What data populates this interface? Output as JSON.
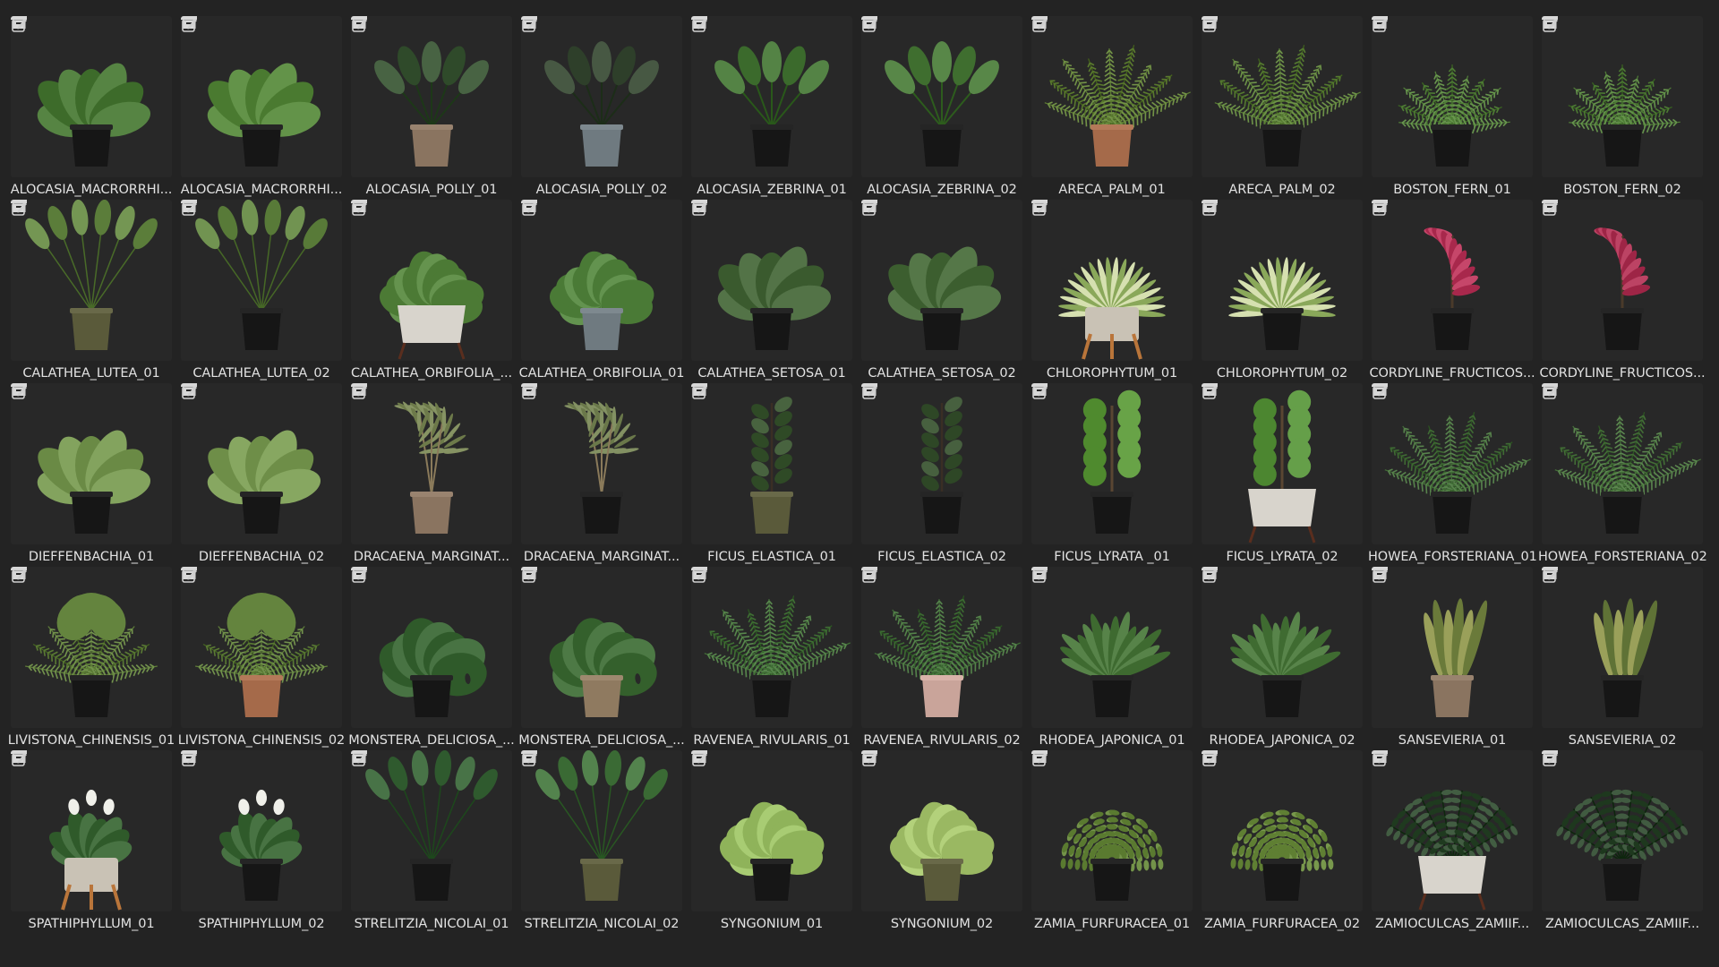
{
  "assets": [
    {
      "label": "ALOCASIA_MACRORRHI...",
      "plant": "broad",
      "leaf": "#3d6b2a",
      "pot": "black"
    },
    {
      "label": "ALOCASIA_MACRORRHI...",
      "plant": "broad",
      "leaf": "#4a7a30",
      "pot": "black"
    },
    {
      "label": "ALOCASIA_POLLY_01",
      "plant": "arrow",
      "leaf": "#2f4a2a",
      "pot": "tan"
    },
    {
      "label": "ALOCASIA_POLLY_02",
      "plant": "arrow",
      "leaf": "#2e3f2a",
      "pot": "grey"
    },
    {
      "label": "ALOCASIA_ZEBRINA_01",
      "plant": "arrow",
      "leaf": "#3b6a2c",
      "pot": "black"
    },
    {
      "label": "ALOCASIA_ZEBRINA_02",
      "plant": "arrow",
      "leaf": "#3f6e2f",
      "pot": "black"
    },
    {
      "label": "ARECA_PALM_01",
      "plant": "palm",
      "leaf": "#5a7a2e",
      "pot": "terracotta"
    },
    {
      "label": "ARECA_PALM_02",
      "plant": "palm",
      "leaf": "#557a30",
      "pot": "black"
    },
    {
      "label": "BOSTON_FERN_01",
      "plant": "fern",
      "leaf": "#4f7d35",
      "pot": "black"
    },
    {
      "label": "BOSTON_FERN_02",
      "plant": "fern",
      "leaf": "#4c7a33",
      "pot": "black"
    },
    {
      "label": "CALATHEA_LUTEA_01",
      "plant": "tall",
      "leaf": "#5b7d3a",
      "pot": "olive"
    },
    {
      "label": "CALATHEA_LUTEA_02",
      "plant": "tall",
      "leaf": "#587a38",
      "pot": "black"
    },
    {
      "label": "CALATHEA_ORBIFOLIA_...",
      "plant": "bushy",
      "leaf": "#4c7a35",
      "pot": "white"
    },
    {
      "label": "CALATHEA_ORBIFOLIA_01",
      "plant": "bushy",
      "leaf": "#4a7a36",
      "pot": "grey"
    },
    {
      "label": "CALATHEA_SETOSA_01",
      "plant": "broad",
      "leaf": "#3a5a2e",
      "pot": "black"
    },
    {
      "label": "CALATHEA_SETOSA_02",
      "plant": "broad",
      "leaf": "#3c5e2f",
      "pot": "black"
    },
    {
      "label": "CHLOROPHYTUM_01",
      "plant": "spider",
      "leaf": "#8aa85a",
      "pot": "stand"
    },
    {
      "label": "CHLOROPHYTUM_02",
      "plant": "spider",
      "leaf": "#8aa85a",
      "pot": "black"
    },
    {
      "label": "CORDYLINE_FRUCTICOS...",
      "plant": "cordyline",
      "leaf": "#a8284c",
      "pot": "black"
    },
    {
      "label": "CORDYLINE_FRUCTICOS...",
      "plant": "cordyline",
      "leaf": "#9e2546",
      "pot": "black"
    },
    {
      "label": "DIEFFENBACHIA_01",
      "plant": "broad",
      "leaf": "#6a8a45",
      "pot": "black"
    },
    {
      "label": "DIEFFENBACHIA_02",
      "plant": "broad",
      "leaf": "#6e8e48",
      "pot": "black"
    },
    {
      "label": "DRACAENA_MARGINAT...",
      "plant": "dracaena",
      "leaf": "#6d7a4a",
      "pot": "tan"
    },
    {
      "label": "DRACAENA_MARGINAT...",
      "plant": "dracaena",
      "leaf": "#6a784a",
      "pot": "black"
    },
    {
      "label": "FICUS_ELASTICA_01",
      "plant": "ficus",
      "leaf": "#2f4a26",
      "pot": "olive"
    },
    {
      "label": "FICUS_ELASTICA_02",
      "plant": "ficus",
      "leaf": "#2e4726",
      "pot": "black"
    },
    {
      "label": "FICUS_LYRATA _01",
      "plant": "fiddle",
      "leaf": "#4f8a2e",
      "pot": "black"
    },
    {
      "label": "FICUS_LYRATA_02",
      "plant": "fiddle",
      "leaf": "#4c8630",
      "pot": "white"
    },
    {
      "label": "HOWEA_FORSTERIANA_01",
      "plant": "palm",
      "leaf": "#3f6a34",
      "pot": "black"
    },
    {
      "label": "HOWEA_FORSTERIANA_02",
      "plant": "palm",
      "leaf": "#426d36",
      "pot": "black"
    },
    {
      "label": "LIVISTONA_CHINENSIS_01",
      "plant": "fanpalm",
      "leaf": "#5a7a34",
      "pot": "black"
    },
    {
      "label": "LIVISTONA_CHINENSIS_02",
      "plant": "fanpalm",
      "leaf": "#5a7a34",
      "pot": "terracotta"
    },
    {
      "label": "MONSTERA_DELICIOSA_...",
      "plant": "monstera",
      "leaf": "#2f5a2a",
      "pot": "black"
    },
    {
      "label": "MONSTERA_DELICIOSA_...",
      "plant": "monstera",
      "leaf": "#34602c",
      "pot": "basket"
    },
    {
      "label": "RAVENEA_RIVULARIS_01",
      "plant": "palm",
      "leaf": "#3f6e34",
      "pot": "black"
    },
    {
      "label": "RAVENEA_RIVULARIS_02",
      "plant": "palm",
      "leaf": "#3c6a32",
      "pot": "pink"
    },
    {
      "label": "RHODEA_JAPONICA_01",
      "plant": "spiky",
      "leaf": "#3e6a30",
      "pot": "black"
    },
    {
      "label": "RHODEA_JAPONICA_02",
      "plant": "spiky",
      "leaf": "#3f6b31",
      "pot": "black"
    },
    {
      "label": "SANSEVIERIA_01",
      "plant": "snake",
      "leaf": "#6a7a3a",
      "pot": "tan"
    },
    {
      "label": "SANSEVIERIA_02",
      "plant": "snake",
      "leaf": "#5f7236",
      "pot": "black"
    },
    {
      "label": "SPATHIPHYLLUM_01",
      "plant": "peace",
      "leaf": "#2f5a2a",
      "pot": "stand"
    },
    {
      "label": "SPATHIPHYLLUM_02",
      "plant": "peace",
      "leaf": "#2f5a2a",
      "pot": "black"
    },
    {
      "label": "STRELITZIA_NICOLAI_01",
      "plant": "tall",
      "leaf": "#2f5a2e",
      "pot": "black"
    },
    {
      "label": "STRELITZIA_NICOLAI_02",
      "plant": "tall",
      "leaf": "#3a6a34",
      "pot": "olive"
    },
    {
      "label": "SYNGONIUM_01",
      "plant": "bushy",
      "leaf": "#8fb35a",
      "pot": "black"
    },
    {
      "label": "SYNGONIUM_02",
      "plant": "bushy",
      "leaf": "#9ab862",
      "pot": "olive"
    },
    {
      "label": "ZAMIA_FURFURACEA_01",
      "plant": "zamia",
      "leaf": "#5a7a30",
      "pot": "black"
    },
    {
      "label": "ZAMIA_FURFURACEA_02",
      "plant": "zamia",
      "leaf": "#5f7f33",
      "pot": "black"
    },
    {
      "label": "ZAMIOCULCAS_ZAMIIF...",
      "plant": "zz",
      "leaf": "#1f3a1f",
      "pot": "white"
    },
    {
      "label": "ZAMIOCULCAS_ZAMIIF...",
      "plant": "zz",
      "leaf": "#1e381e",
      "pot": "black"
    }
  ],
  "pot_colors": {
    "black": "#161616",
    "tan": "#8a7460",
    "grey": "#6f7a80",
    "terracotta": "#a56a4a",
    "olive": "#5a5a3a",
    "white": "#d8d4cc",
    "stand": "#c9c2b5",
    "pink": "#c9a49a",
    "basket": "#8f7a60"
  },
  "icons": {
    "mark": "asset-mark-icon",
    "edit": "edit-icon"
  }
}
